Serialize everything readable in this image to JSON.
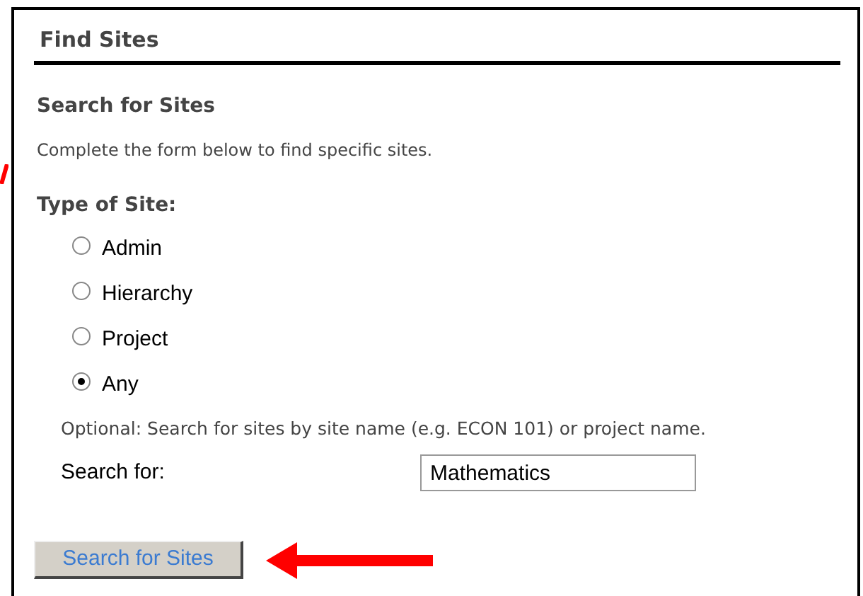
{
  "panel": {
    "title": "Find Sites"
  },
  "section": {
    "heading": "Search for Sites",
    "description": "Complete the form below to find specific sites."
  },
  "site_type": {
    "label": "Type of Site:",
    "options": [
      {
        "label": "Admin",
        "selected": false
      },
      {
        "label": "Hierarchy",
        "selected": false
      },
      {
        "label": "Project",
        "selected": false
      },
      {
        "label": "Any",
        "selected": true
      }
    ]
  },
  "hint": "Optional: Search for sites by site name (e.g. ECON 101) or project name.",
  "search": {
    "label": "Search for:",
    "value": "Mathematics"
  },
  "submit_button": "Search for Sites"
}
